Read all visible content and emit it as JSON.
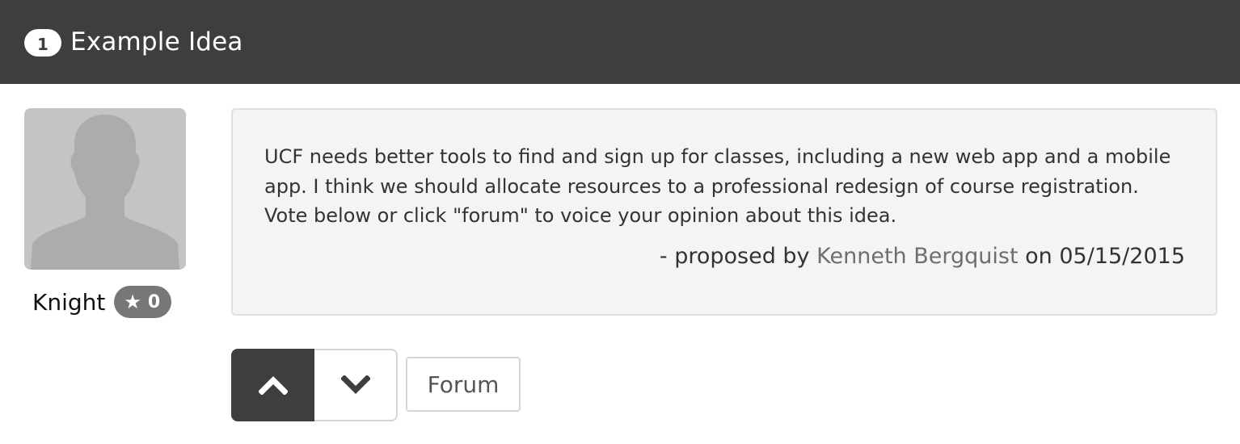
{
  "header": {
    "number": "1",
    "title": "Example Idea"
  },
  "user": {
    "name": "Knight",
    "karma": "0",
    "karma_icon": "star-icon"
  },
  "idea": {
    "text": "UCF needs better tools to find and sign up for classes, including a new web app and a mobile app. I think we should allocate resources to a professional redesign of course registration. Vote below or click \"forum\" to voice your opinion about this idea.",
    "proposed_prefix": "- proposed by",
    "author": "Kenneth Bergquist",
    "date_prefix": "on",
    "date": "05/15/2015"
  },
  "actions": {
    "upvote_icon": "chevron-up-icon",
    "downvote_icon": "chevron-down-icon",
    "forum_label": "Forum"
  },
  "colors": {
    "header_bg": "#3e3e3e",
    "idea_bg": "#f4f4f4",
    "karma_badge": "#777777",
    "upvote_active": "#3e3e3e"
  }
}
